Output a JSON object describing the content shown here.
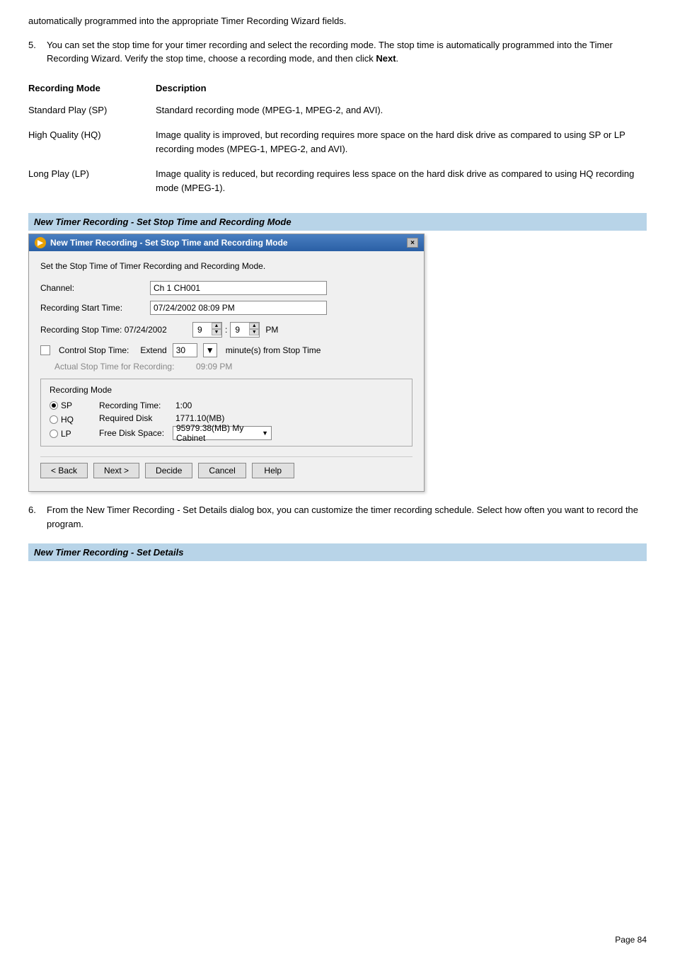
{
  "intro": {
    "text": "automatically programmed into the appropriate Timer Recording Wizard fields."
  },
  "item5": {
    "number": "5.",
    "text_before": "You can set the stop time for your timer recording and select the recording mode. The stop time is automatically programmed into the Timer Recording Wizard. Verify the stop time, choose a recording mode, and then click ",
    "bold_text": "Next",
    "text_after": "."
  },
  "table": {
    "col1_header": "Recording Mode",
    "col2_header": "Description",
    "rows": [
      {
        "mode": "Standard Play (SP)",
        "description": "Standard recording mode (MPEG-1, MPEG-2, and AVI)."
      },
      {
        "mode": "High Quality (HQ)",
        "description": "Image quality is improved, but recording requires more space on the hard disk drive as compared to using SP or LP recording modes (MPEG-1, MPEG-2, and AVI)."
      },
      {
        "mode": "Long Play (LP)",
        "description": "Image quality is reduced, but recording requires less space on the hard disk drive as compared to using HQ recording mode (MPEG-1)."
      }
    ]
  },
  "section1": {
    "header": "New Timer Recording - Set Stop Time and Recording Mode"
  },
  "dialog": {
    "title": "New Timer Recording - Set Stop Time and Recording Mode",
    "close_label": "×",
    "description": "Set the Stop Time of Timer Recording and Recording Mode.",
    "channel_label": "Channel:",
    "channel_value": "Ch 1 CH001",
    "start_time_label": "Recording Start Time:",
    "start_time_value": "07/24/2002 08:09 PM",
    "stop_time_label": "Recording Stop Time: 07/24/2002",
    "stop_hour": "9",
    "stop_min": "9",
    "stop_ampm": "PM",
    "control_stop_label": "Control Stop Time:",
    "extend_label": "Extend",
    "extend_value": "30",
    "minute_label": "minute(s) from Stop Time",
    "actual_stop_label": "Actual Stop Time for Recording:",
    "actual_stop_value": "09:09 PM",
    "recording_mode_title": "Recording Mode",
    "modes": [
      {
        "label": "SP",
        "selected": true
      },
      {
        "label": "HQ",
        "selected": false
      },
      {
        "label": "LP",
        "selected": false
      }
    ],
    "recording_time_label": "Recording Time:",
    "recording_time_value": "1:00",
    "required_disk_label": "Required Disk",
    "required_disk_value": "1771.10(MB)",
    "free_disk_label": "Free Disk Space:",
    "free_disk_value": "95979.38(MB) My Cabinet",
    "back_btn": "< Back",
    "next_btn": "Next >",
    "decide_btn": "Decide",
    "cancel_btn": "Cancel",
    "help_btn": "Help"
  },
  "item6": {
    "number": "6.",
    "text": "From the New Timer Recording - Set Details dialog box, you can customize the timer recording schedule. Select how often you want to record the program."
  },
  "section2": {
    "header": "New Timer Recording - Set Details"
  },
  "page_number": "Page 84"
}
